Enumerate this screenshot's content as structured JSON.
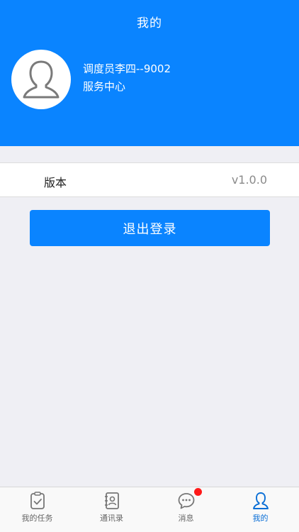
{
  "header": {
    "title": "我的"
  },
  "profile": {
    "name": "调度员李四--9002",
    "department": "服务中心",
    "avatar_icon": "person-outline-icon"
  },
  "settings": {
    "version_label": "版本",
    "version_value": "v1.0.0"
  },
  "actions": {
    "logout_label": "退出登录"
  },
  "tabbar": {
    "items": [
      {
        "label": "我的任务",
        "icon": "clipboard-check-icon",
        "active": false
      },
      {
        "label": "通讯录",
        "icon": "contacts-book-icon",
        "active": false
      },
      {
        "label": "消息",
        "icon": "chat-bubble-icon",
        "active": false,
        "badge": true
      },
      {
        "label": "我的",
        "icon": "person-icon",
        "active": true
      }
    ]
  },
  "colors": {
    "brand": "#0a84ff",
    "badge": "#ff1a1a",
    "background": "#efeff4"
  }
}
